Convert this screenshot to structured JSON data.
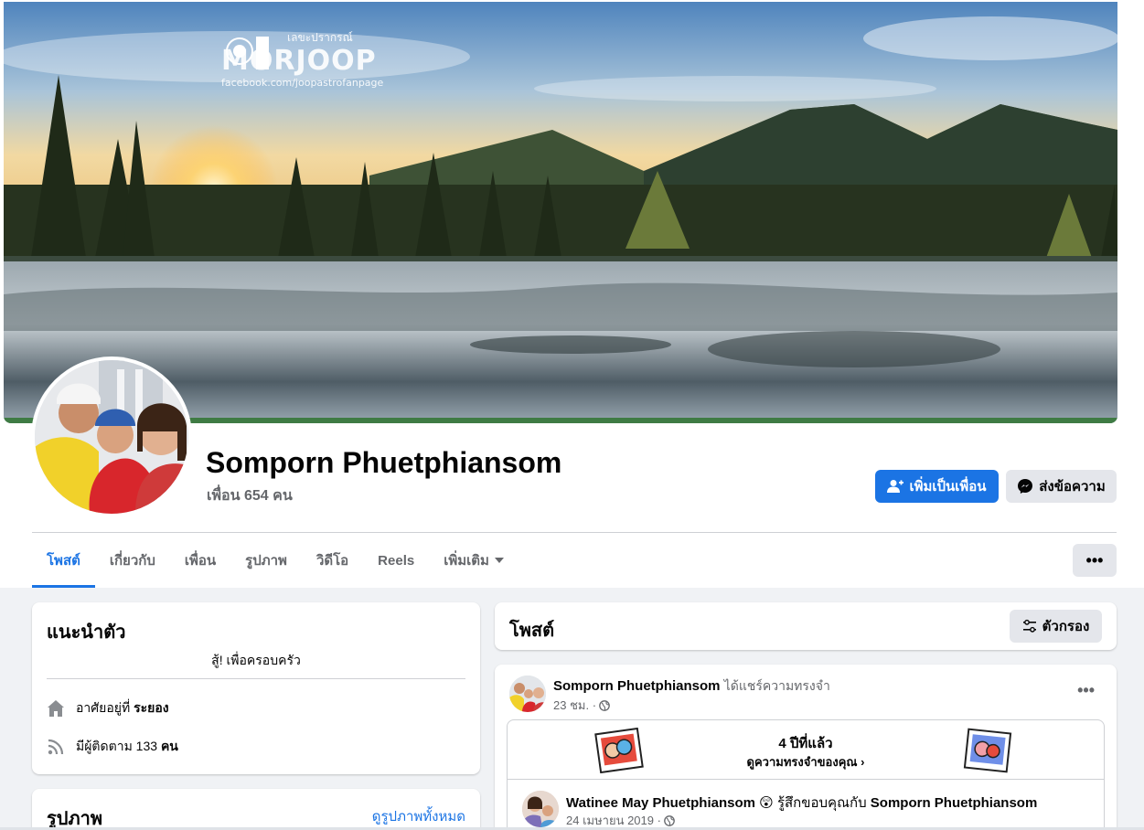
{
  "cover": {
    "watermark_sub": "เลขะปรากรณ์",
    "watermark_title": "MORJOOP",
    "watermark_link": "facebook.com/joopastrofanpage"
  },
  "profile": {
    "name": "Somporn Phuetphiansom",
    "friends": "เพื่อน 654 คน",
    "add_friend_label": "เพิ่มเป็นเพื่อน",
    "message_label": "ส่งข้อความ"
  },
  "tabs": [
    {
      "label": "โพสต์"
    },
    {
      "label": "เกี่ยวกับ"
    },
    {
      "label": "เพื่อน"
    },
    {
      "label": "รูปภาพ"
    },
    {
      "label": "วิดีโอ"
    },
    {
      "label": "Reels"
    },
    {
      "label": "เพิ่มเติม"
    }
  ],
  "more_button": "•••",
  "intro": {
    "title": "แนะนำตัว",
    "bio": "สู้! เพื่อครอบครัว",
    "lives_prefix": "อาศัยอยู่ที่",
    "lives_place": "ระยอง",
    "followers_prefix": "มีผู้ติดตาม 133",
    "followers_suffix": "คน"
  },
  "photos": {
    "title": "รูปภาพ",
    "see_all": "ดูรูปภาพทั้งหมด"
  },
  "posts_header": {
    "title": "โพสต์",
    "filter_label": "ตัวกรอง"
  },
  "post": {
    "author": "Somporn Phuetphiansom",
    "action": "ได้แชร์ความทรงจำ",
    "time": "23 ชม. ·",
    "memory_title": "4 ปีที่แล้ว",
    "memory_link": "ดูความทรงจำของคุณ",
    "shared_author": "Watinee May Phuetphiansom",
    "shared_emoji": "😲",
    "shared_action": "รู้สึกขอบคุณกับ",
    "shared_target": "Somporn Phuetphiansom",
    "shared_time": "24 เมษายน 2019 ·"
  },
  "colors": {
    "accent": "#1b74e4",
    "page_bg": "#f0f2f5",
    "secondary_btn": "#e4e6eb",
    "muted_text": "#65676b"
  },
  "icons": {
    "add_friend": "person-plus-icon",
    "message": "messenger-icon",
    "home": "home-icon",
    "followers": "rss-icon",
    "filter": "sliders-icon",
    "globe": "globe-icon"
  }
}
